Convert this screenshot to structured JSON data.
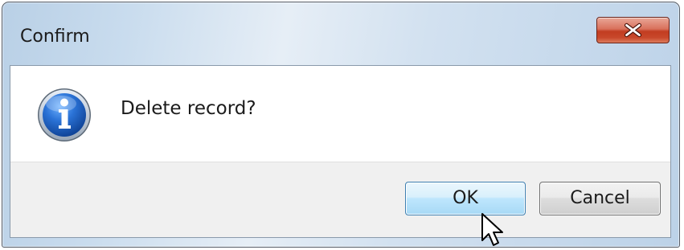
{
  "window": {
    "title": "Confirm"
  },
  "message": {
    "text": "Delete record?",
    "icon": "info-icon"
  },
  "buttons": {
    "ok_label": "OK",
    "cancel_label": "Cancel",
    "close_icon": "close-icon"
  },
  "colors": {
    "close_button_red": "#c23d21",
    "ok_button_highlight": "#bee6fd",
    "info_icon_blue": "#1f5fb8"
  }
}
